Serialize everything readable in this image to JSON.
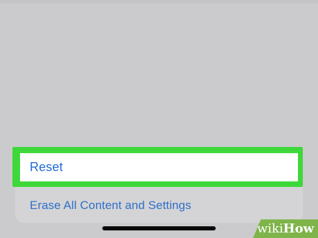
{
  "settings_sheet": {
    "reset_label": "Reset",
    "erase_label": "Erase All Content and Settings"
  },
  "colors": {
    "highlight": "#3ed83a",
    "link_blue": "#1e6ad6",
    "background": "#cbcbcd"
  },
  "watermark": {
    "wiki": "wiki",
    "how": "How"
  }
}
